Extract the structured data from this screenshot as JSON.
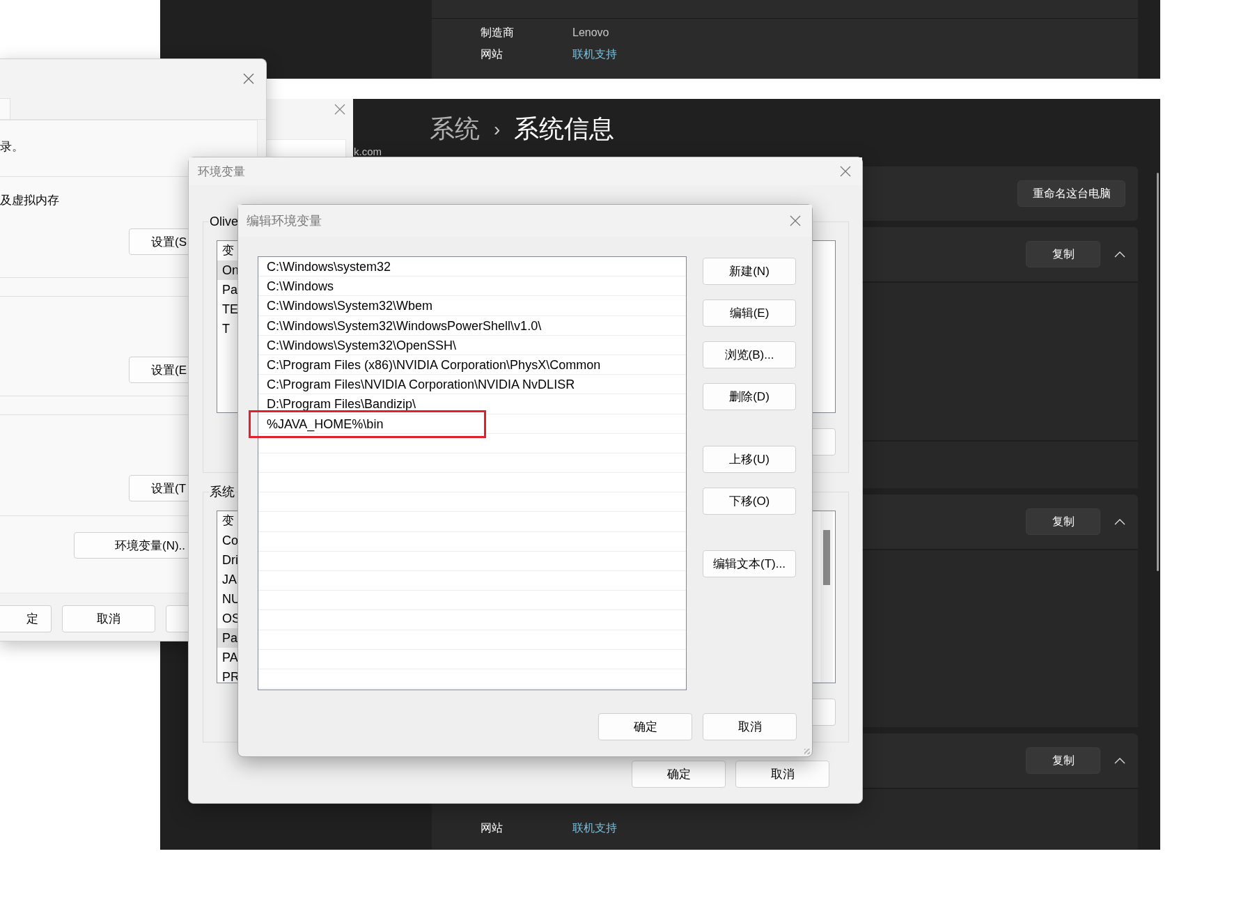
{
  "info_window_top": {
    "rows": [
      {
        "label": "制造商",
        "value": "Lenovo",
        "kind": "text"
      },
      {
        "label": "网站",
        "value": "联机支持",
        "kind": "link"
      }
    ]
  },
  "settings_window": {
    "breadcrumb": [
      {
        "label": "系统",
        "current": false
      },
      {
        "label": "系统信息",
        "current": true
      }
    ],
    "separator": "›",
    "fragment": "k.com",
    "cards": [
      {
        "kind": "action",
        "button": "重命名这台电脑"
      },
      {
        "kind": "expander",
        "button": "复制",
        "expanded": true
      },
      {
        "kind": "expander",
        "button": "复制",
        "expanded": true
      },
      {
        "kind": "expander",
        "button": "复制",
        "expanded": true,
        "rows": [
          {
            "label": "网站",
            "value": "联机支持",
            "kind": "link"
          }
        ]
      }
    ]
  },
  "system_properties": {
    "texts": [
      "录。",
      "及虚拟内存"
    ],
    "setting_buttons": [
      "设置(S",
      "设置(E",
      "设置(T"
    ],
    "env_button": "环境变量(N)..",
    "footer_buttons": [
      "定",
      "取消"
    ]
  },
  "env_dialog": {
    "title": "环境变量",
    "user_group": {
      "label": "Olive",
      "column_header": "变",
      "rows": [
        {
          "text": "On",
          "selected": true
        },
        {
          "text": "Pa",
          "selected": false
        },
        {
          "text": "TE",
          "selected": false
        },
        {
          "text": "T",
          "selected": false
        }
      ]
    },
    "system_group": {
      "label": "系统",
      "column_header": "变",
      "rows": [
        {
          "text": "Co",
          "selected": false
        },
        {
          "text": "Dri",
          "selected": false
        },
        {
          "text": "JA",
          "selected": false
        },
        {
          "text": "NU",
          "selected": false
        },
        {
          "text": "OS",
          "selected": false
        },
        {
          "text": "Pa",
          "selected": true
        },
        {
          "text": "PA",
          "selected": false
        },
        {
          "text": "PR",
          "selected": false
        }
      ]
    },
    "buttons": [
      "确定",
      "取消"
    ]
  },
  "edit_dialog": {
    "title": "编辑环境变量",
    "entries": [
      {
        "text": "C:\\Windows\\system32",
        "marked": false
      },
      {
        "text": "C:\\Windows",
        "marked": false
      },
      {
        "text": "C:\\Windows\\System32\\Wbem",
        "marked": false
      },
      {
        "text": "C:\\Windows\\System32\\WindowsPowerShell\\v1.0\\",
        "marked": false
      },
      {
        "text": "C:\\Windows\\System32\\OpenSSH\\",
        "marked": false
      },
      {
        "text": "C:\\Program Files (x86)\\NVIDIA Corporation\\PhysX\\Common",
        "marked": false
      },
      {
        "text": "C:\\Program Files\\NVIDIA Corporation\\NVIDIA NvDLISR",
        "marked": false
      },
      {
        "text": "D:\\Program Files\\Bandizip\\",
        "marked": false
      },
      {
        "text": "%JAVA_HOME%\\bin",
        "marked": true
      }
    ],
    "side_buttons": [
      {
        "label": "新建(N)",
        "kind": "action"
      },
      {
        "label": "编辑(E)",
        "kind": "action"
      },
      {
        "label": "浏览(B)...",
        "kind": "action"
      },
      {
        "label": "删除(D)",
        "kind": "action"
      },
      {
        "label": "上移(U)",
        "kind": "move"
      },
      {
        "label": "下移(O)",
        "kind": "action"
      },
      {
        "label": "编辑文本(T)...",
        "kind": "text"
      }
    ],
    "buttons": [
      "确定",
      "取消"
    ]
  }
}
